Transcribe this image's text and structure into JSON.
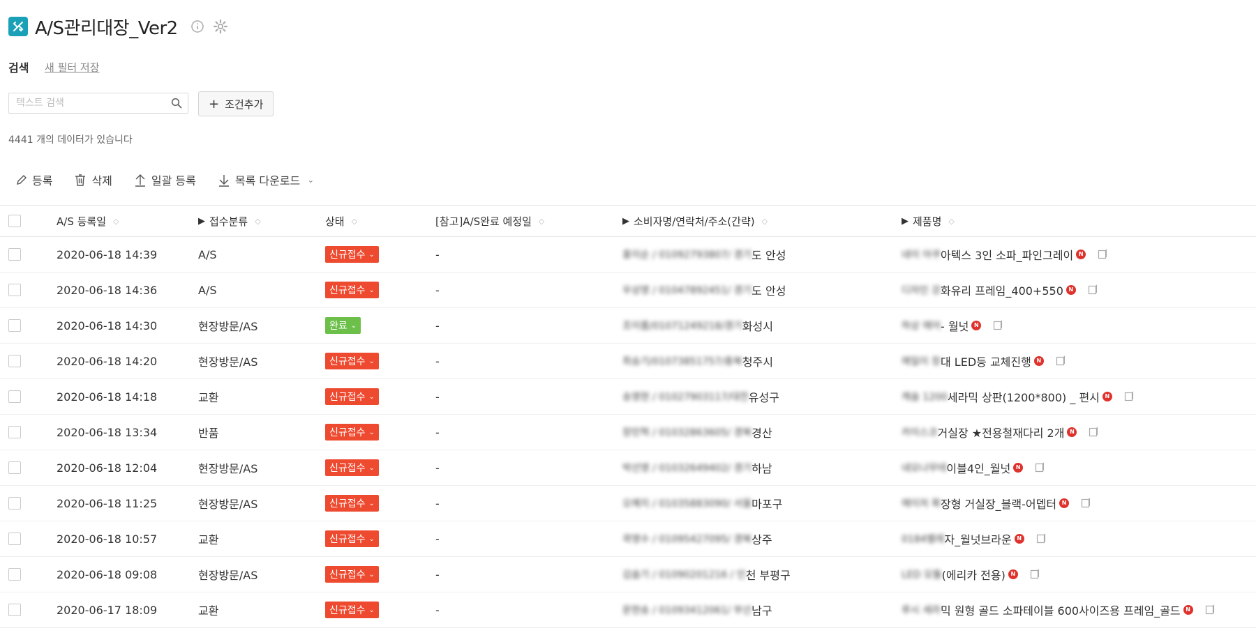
{
  "app": {
    "title": "A/S관리대장_Ver2",
    "accent": "#1aa1b8"
  },
  "filters": {
    "search_tab": "검색",
    "save_filter": "새 필터 저장",
    "search_placeholder": "텍스트 검색",
    "add_condition": "조건추가",
    "count_text": "4441 개의 데이터가 있습니다"
  },
  "toolbar": {
    "register": "등록",
    "delete": "삭제",
    "bulk_register": "일괄 등록",
    "download": "목록 다운로드"
  },
  "table": {
    "headers": {
      "date": "A/S 등록일",
      "category": "접수분류",
      "status": "상태",
      "due": "[참고]A/S완료 예정일",
      "customer": "소비자명/연락처/주소(간략)",
      "product": "제품명"
    },
    "rows": [
      {
        "date": "2020-06-18 14:39",
        "category": "A/S",
        "status": "신규접수",
        "status_color": "#ee4a30",
        "due": "-",
        "cust_blur": "홍이순 / 01092793807/ 경기",
        "cust_tail": "도 안성",
        "prod_blur": "네이 아쿠",
        "prod_tail": "아텍스 3인 소파_파인그레이"
      },
      {
        "date": "2020-06-18 14:36",
        "category": "A/S",
        "status": "신규접수",
        "status_color": "#ee4a30",
        "due": "-",
        "cust_blur": "우상영 / 01047892451/ 경기",
        "cust_tail": "도 안성",
        "prod_blur": "디자인 강",
        "prod_tail": "화유리 프레임_400+550"
      },
      {
        "date": "2020-06-18 14:30",
        "category": "현장방문/AS",
        "status": "완료",
        "status_color": "#6cc04a",
        "due": "-",
        "cust_blur": "조이룸/01071249218/경기",
        "cust_tail": "화성시",
        "prod_blur": "하상 에어",
        "prod_tail": "- 월넛"
      },
      {
        "date": "2020-06-18 14:20",
        "category": "현장방문/AS",
        "status": "신규접수",
        "status_color": "#ee4a30",
        "due": "-",
        "cust_blur": "최승기/01073851757/충북",
        "cust_tail": "청주시",
        "prod_blur": "에일이 장",
        "prod_tail": "대 LED등 교체진행"
      },
      {
        "date": "2020-06-18 14:18",
        "category": "교환",
        "status": "신규접수",
        "status_color": "#ee4a30",
        "due": "-",
        "cust_blur": "송영현 / 01027903117/대전",
        "cust_tail": "유성구",
        "prod_blur": "캐슬 1200",
        "prod_tail": "세라믹 상판(1200*800) _ 편시"
      },
      {
        "date": "2020-06-18 13:34",
        "category": "반품",
        "status": "신규접수",
        "status_color": "#ee4a30",
        "due": "-",
        "cust_blur": "장민혁 / 01032863605/ 경북",
        "cust_tail": "경산",
        "prod_blur": "카이스코",
        "prod_tail": "거실장 ★전용철재다리 2개"
      },
      {
        "date": "2020-06-18 12:04",
        "category": "현장방문/AS",
        "status": "신규접수",
        "status_color": "#ee4a30",
        "due": "-",
        "cust_blur": "박선영 / 01032649402/ 경기",
        "cust_tail": "하남",
        "prod_blur": "네모나무테",
        "prod_tail": "이블4인_월넛"
      },
      {
        "date": "2020-06-18 11:25",
        "category": "현장방문/AS",
        "status": "신규접수",
        "status_color": "#ee4a30",
        "due": "-",
        "cust_blur": "오예지 / 01035883090/ 서울",
        "cust_tail": "마포구",
        "prod_blur": "에이저 확",
        "prod_tail": "장형 거실장_블랙-어뎁터"
      },
      {
        "date": "2020-06-18 10:57",
        "category": "교환",
        "status": "신규접수",
        "status_color": "#ee4a30",
        "due": "-",
        "cust_blur": "곽영수 / 01095427095/ 경북",
        "cust_tail": "상주",
        "prod_blur": "0184벨레",
        "prod_tail": "자_월넛브라운"
      },
      {
        "date": "2020-06-18 09:08",
        "category": "현장방문/AS",
        "status": "신규접수",
        "status_color": "#ee4a30",
        "due": "-",
        "cust_blur": "김슬기 / 01090201216 / 인",
        "cust_tail": "천 부평구",
        "prod_blur": "LED 모듈",
        "prod_tail": "(에리카 전용)"
      },
      {
        "date": "2020-06-17 18:09",
        "category": "교환",
        "status": "신규접수",
        "status_color": "#ee4a30",
        "due": "-",
        "cust_blur": "문현송 / 01093412061/ 부산",
        "cust_tail": "남구",
        "prod_blur": "루시 세라",
        "prod_tail": "믹 원형 골드 소파테이블 600사이즈용 프레임_골드"
      }
    ]
  }
}
